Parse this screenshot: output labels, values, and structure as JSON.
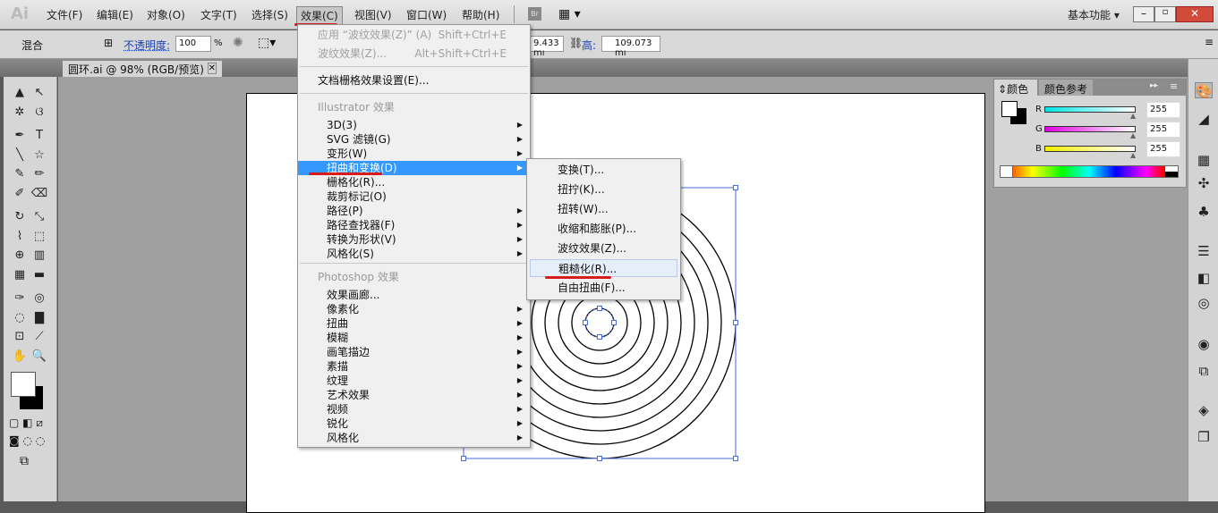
{
  "app": {
    "logo": "Ai",
    "workspace": "基本功能"
  },
  "menubar": [
    "文件(F)",
    "编辑(E)",
    "对象(O)",
    "文字(T)",
    "选择(S)",
    "效果(C)",
    "视图(V)",
    "窗口(W)",
    "帮助(H)"
  ],
  "bridge": "Br",
  "control": {
    "blend": "混合",
    "opacity_label": "不透明度:",
    "opacity": "100",
    "opacity_unit": "%",
    "width": "9.433 mı",
    "height_label": "高:",
    "height": "109.073 mı"
  },
  "document_tab": "圆环.ai @ 98% (RGB/预览)",
  "effect_menu": {
    "top": [
      {
        "label": "应用 “波纹效果(Z)” (A)",
        "shortcut": "Shift+Ctrl+E"
      },
      {
        "label": "波纹效果(Z)...",
        "shortcut": "Alt+Shift+Ctrl+E"
      }
    ],
    "raster_settings": "文档栅格效果设置(E)...",
    "illustrator_header": "Illustrator 效果",
    "illustrator_items": [
      {
        "label": "3D(3)",
        "sub": true
      },
      {
        "label": "SVG 滤镜(G)",
        "sub": true
      },
      {
        "label": "变形(W)",
        "sub": true
      },
      {
        "label": "扭曲和变换(D)",
        "sub": true
      },
      {
        "label": "栅格化(R)...",
        "sub": false
      },
      {
        "label": "裁剪标记(O)",
        "sub": false
      },
      {
        "label": "路径(P)",
        "sub": true
      },
      {
        "label": "路径查找器(F)",
        "sub": true
      },
      {
        "label": "转换为形状(V)",
        "sub": true
      },
      {
        "label": "风格化(S)",
        "sub": true
      }
    ],
    "photoshop_header": "Photoshop 效果",
    "photoshop_items": [
      {
        "label": "效果画廊...",
        "sub": false
      },
      {
        "label": "像素化",
        "sub": true
      },
      {
        "label": "扭曲",
        "sub": true
      },
      {
        "label": "模糊",
        "sub": true
      },
      {
        "label": "画笔描边",
        "sub": true
      },
      {
        "label": "素描",
        "sub": true
      },
      {
        "label": "纹理",
        "sub": true
      },
      {
        "label": "艺术效果",
        "sub": true
      },
      {
        "label": "视频",
        "sub": true
      },
      {
        "label": "锐化",
        "sub": true
      },
      {
        "label": "风格化",
        "sub": true
      }
    ]
  },
  "distort_submenu": [
    "变换(T)...",
    "扭拧(K)...",
    "扭转(W)...",
    "收缩和膨胀(P)...",
    "波纹效果(Z)...",
    "粗糙化(R)...",
    "自由扭曲(F)..."
  ],
  "color_panel": {
    "tabs": [
      "颜色",
      "颜色参考"
    ],
    "channels": [
      {
        "name": "R",
        "value": "255",
        "color": "#00e5e5"
      },
      {
        "name": "G",
        "value": "255",
        "color": "#e000e0"
      },
      {
        "name": "B",
        "value": "255",
        "color": "#f0f000"
      }
    ]
  }
}
